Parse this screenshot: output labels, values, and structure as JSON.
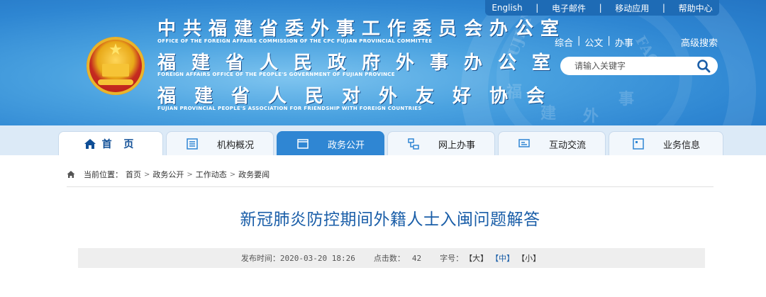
{
  "topbar": {
    "links": [
      "English",
      "电子邮件",
      "移动应用",
      "帮助中心"
    ],
    "separator": "|"
  },
  "org": {
    "line1_cn": "中共福建省委外事工作委员会办公室",
    "line1_en": "OFFICE OF THE FOREIGN AFFAIRS COMMISSION OF THE CPC FUJIAN PROVINCIAL COMMITTEE",
    "line2_cn": "福建省人民政府外事办公室",
    "line2_en": "FOREIGN AFFAIRS OFFICE OF THE PEOPLE'S GOVERNMENT OF FUJIAN PROVINCE",
    "line3_cn": "福建省人民对外友好协会",
    "line3_en": "FUJIAN PROVINCIAL PEOPLE'S ASSOCIATION FOR FRIENDSHIP WITH FOREIGN COUNTRIES"
  },
  "watermark": {
    "left": "FUJIAN",
    "right": "FAO",
    "cn1": "福",
    "cn2": "建",
    "cn3": "外",
    "cn4": "事"
  },
  "search_area": {
    "tabs": [
      "综合",
      "公文",
      "办事"
    ],
    "tab_sep": "|",
    "advanced": "高级搜索",
    "placeholder": "请输入关键字"
  },
  "nav": {
    "items": [
      {
        "label": "首 页",
        "icon": "home-icon"
      },
      {
        "label": "机构概况",
        "icon": "list-icon"
      },
      {
        "label": "政务公开",
        "icon": "folder-icon"
      },
      {
        "label": "网上办事",
        "icon": "network-icon"
      },
      {
        "label": "互动交流",
        "icon": "chat-icon"
      },
      {
        "label": "业务信息",
        "icon": "window-icon"
      }
    ],
    "active_index": 2
  },
  "breadcrumb": {
    "prefix": "当前位置：",
    "items": [
      "首页",
      "政务公开",
      "工作动态",
      "政务要闻"
    ],
    "separator": ">"
  },
  "article": {
    "title": "新冠肺炎防控期间外籍人士入闽问题解答",
    "publish_label": "发布时间：",
    "publish_time": "2020-03-20 18:26",
    "clicks_label": "点击数：",
    "clicks": "42",
    "font_label": "字号：",
    "font_sizes": [
      "【大】",
      "【中】",
      "【小】"
    ]
  },
  "colors": {
    "header_blue": "#2e86d2",
    "nav_active": "#2f86d3",
    "title_blue": "#1a5ea8",
    "topbar": "#1e6bb5"
  }
}
